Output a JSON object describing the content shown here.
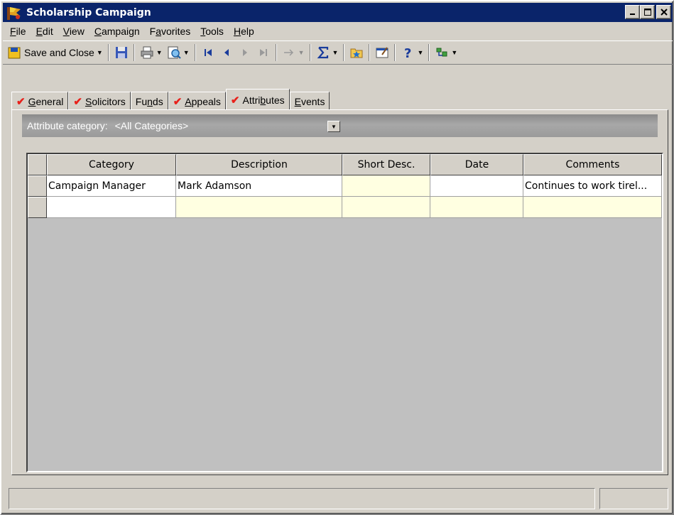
{
  "window": {
    "title": "Scholarship Campaign"
  },
  "menu": [
    {
      "pre": "",
      "acc": "F",
      "post": "ile"
    },
    {
      "pre": "",
      "acc": "E",
      "post": "dit"
    },
    {
      "pre": "",
      "acc": "V",
      "post": "iew"
    },
    {
      "pre": "",
      "acc": "C",
      "post": "ampaign"
    },
    {
      "pre": "F",
      "acc": "a",
      "post": "vorites"
    },
    {
      "pre": "",
      "acc": "T",
      "post": "ools"
    },
    {
      "pre": "",
      "acc": "H",
      "post": "elp"
    }
  ],
  "toolbar": {
    "save_close_label": "Save and Close"
  },
  "tabs": [
    {
      "pre": "",
      "acc": "G",
      "post": "eneral",
      "checked": true
    },
    {
      "pre": "",
      "acc": "S",
      "post": "olicitors",
      "checked": true
    },
    {
      "pre": "Fu",
      "acc": "n",
      "post": "ds",
      "checked": false
    },
    {
      "pre": "",
      "acc": "A",
      "post": "ppeals",
      "checked": true
    },
    {
      "pre": "Attri",
      "acc": "b",
      "post": "utes",
      "checked": true
    },
    {
      "pre": "",
      "acc": "E",
      "post": "vents",
      "checked": false
    }
  ],
  "filter": {
    "label": "Attribute category:",
    "value": "<All Categories>"
  },
  "grid": {
    "columns": [
      "Category",
      "Description",
      "Short Desc.",
      "Date",
      "Comments"
    ],
    "rows": [
      [
        "Campaign Manager",
        "Mark Adamson",
        "",
        "",
        "Continues to work tirel..."
      ],
      [
        "",
        "",
        "",
        "",
        ""
      ]
    ]
  },
  "colors": {
    "titlebar": "#0a246a",
    "window": "#d4d0c8",
    "highlight_cell": "#ffffe1",
    "check": "#e8201a"
  }
}
